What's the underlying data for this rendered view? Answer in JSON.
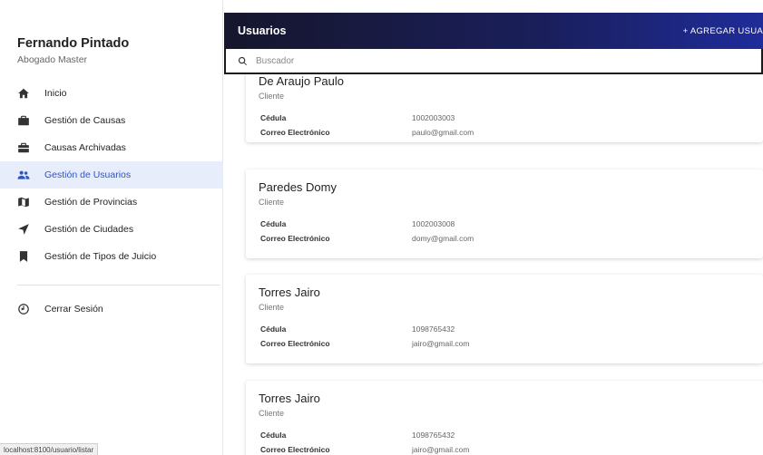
{
  "sidebar": {
    "user_name": "Fernando Pintado",
    "user_role": "Abogado Master",
    "items": [
      {
        "label": "Inicio",
        "icon": "home-icon",
        "active": false
      },
      {
        "label": "Gestión de Causas",
        "icon": "briefcase-icon",
        "active": false
      },
      {
        "label": "Causas Archivadas",
        "icon": "archive-briefcase-icon",
        "active": false
      },
      {
        "label": "Gestión de Usuarios",
        "icon": "people-icon",
        "active": true
      },
      {
        "label": "Gestión de Provincias",
        "icon": "map-icon",
        "active": false
      },
      {
        "label": "Gestión de Ciudades",
        "icon": "navigate-icon",
        "active": false
      },
      {
        "label": "Gestión de Tipos de Juicio",
        "icon": "bookmark-icon",
        "active": false
      }
    ],
    "logout_label": "Cerrar Sesión",
    "status_url": "localhost:8100/usuario/listar"
  },
  "header": {
    "title": "Usuarios",
    "add_button": "+ AGREGAR USUA"
  },
  "search": {
    "placeholder": "Buscador"
  },
  "labels": {
    "cedula": "Cédula",
    "correo": "Correo Electrónico"
  },
  "users": [
    {
      "name": "De Araujo Paulo",
      "type": "Cliente",
      "cedula": "1002003003",
      "correo": "paulo@gmail.com"
    },
    {
      "name": "Paredes Domy",
      "type": "Cliente",
      "cedula": "1002003008",
      "correo": "domy@gmail.com"
    },
    {
      "name": "Torres Jairo",
      "type": "Cliente",
      "cedula": "1098765432",
      "correo": "jairo@gmail.com"
    },
    {
      "name": "Torres Jairo",
      "type": "Cliente",
      "cedula": "1098765432",
      "correo": "jairo@gmail.com"
    }
  ],
  "colors": {
    "accent": "#2d55c4",
    "active_bg": "#e7edfb",
    "topbar_start": "#16162c",
    "topbar_end": "#1f2c9a"
  }
}
